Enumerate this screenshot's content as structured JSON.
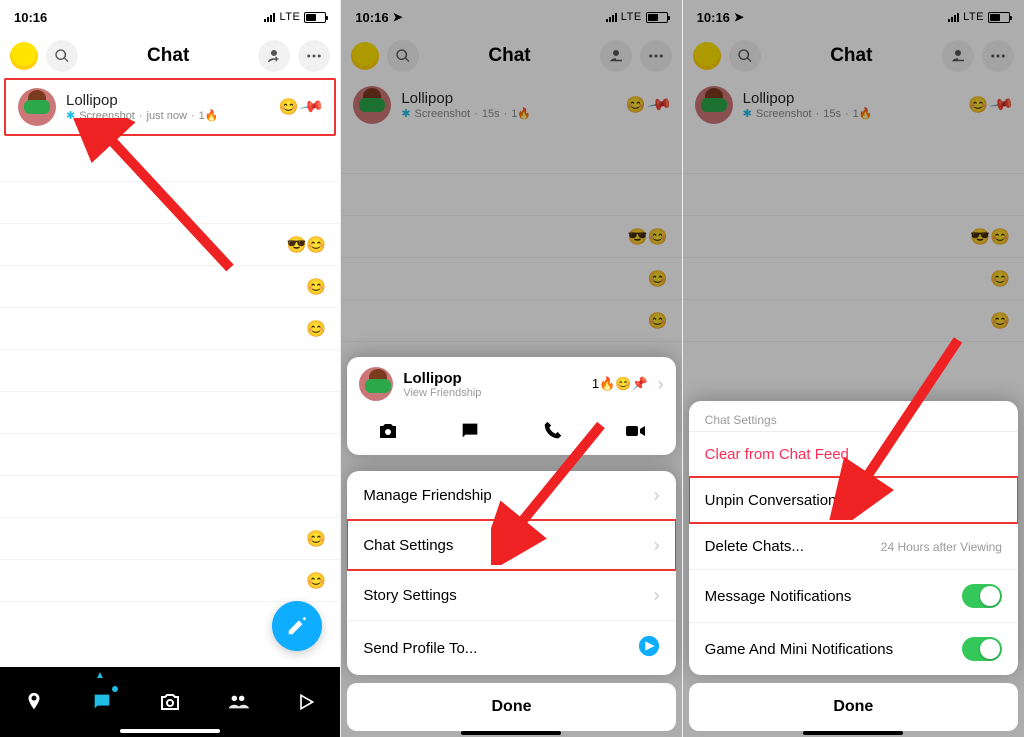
{
  "status": {
    "time": "10:16",
    "network": "LTE"
  },
  "header": {
    "title": "Chat"
  },
  "chat": {
    "name": "Lollipop",
    "statusLabel": "Screenshot",
    "time1": "just now",
    "time2": "15s",
    "streak": "1🔥",
    "emoji": "😊",
    "pin": "📌"
  },
  "feed": {
    "e1": "😎😊",
    "e2": "😊",
    "e3": "😊",
    "e4": "😊",
    "e5": "😊"
  },
  "card": {
    "name": "Lollipop",
    "sub": "View Friendship",
    "badges": "1🔥😊📌"
  },
  "menu": {
    "manage": "Manage Friendship",
    "chatSettings": "Chat Settings",
    "storySettings": "Story Settings",
    "sendProfile": "Send Profile To..."
  },
  "settings": {
    "heading": "Chat Settings",
    "clear": "Clear from Chat Feed",
    "unpin": "Unpin Conversation",
    "delete": "Delete Chats...",
    "deleteSub": "24 Hours after Viewing",
    "msgNotif": "Message Notifications",
    "gameNotif": "Game And Mini Notifications"
  },
  "done": "Done"
}
